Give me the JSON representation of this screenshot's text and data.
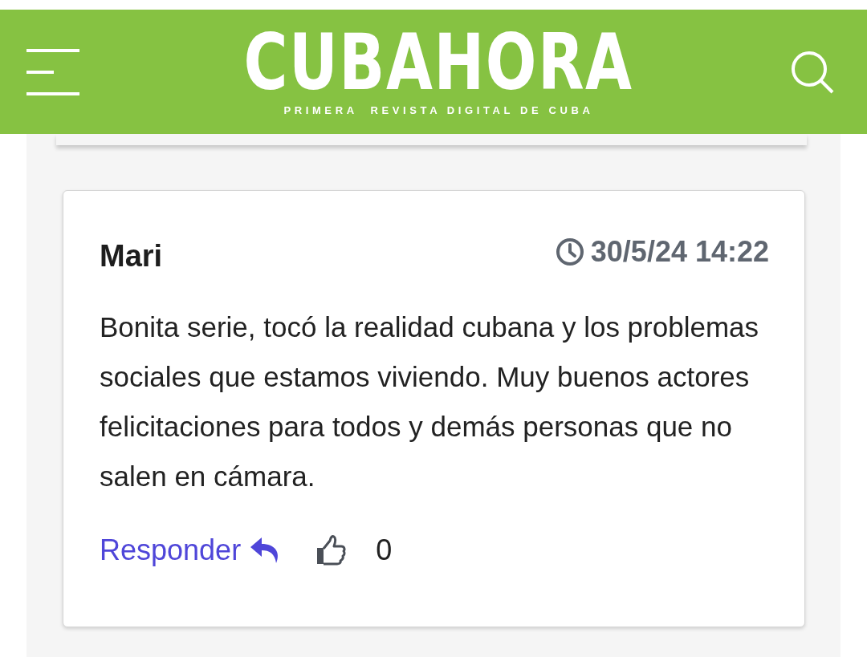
{
  "header": {
    "logo": "CUBAHORA",
    "tagline": "PRIMERA  REVISTA DIGITAL DE CUBA"
  },
  "comment": {
    "author": "Mari",
    "time": "30/5/24 14:22",
    "text": "Bonita serie, tocó la realidad cubana y los problemas sociales que estamos viviendo. Muy buenos actores felicitaciones para todos y demás personas que no salen en cámara.",
    "reply": "Responder",
    "likes": "0"
  }
}
